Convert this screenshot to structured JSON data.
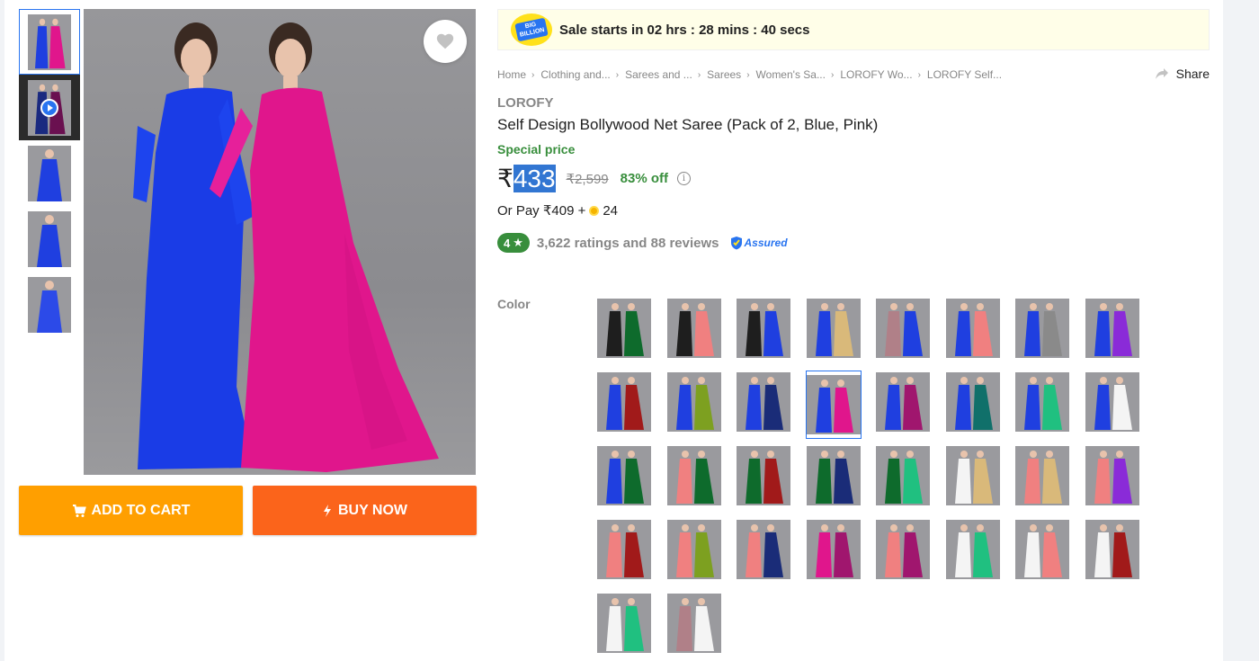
{
  "sale_banner": {
    "badge": "THE BIG BILLION DAYS",
    "text": "Sale starts in 02 hrs : 28 mins : 40 secs"
  },
  "breadcrumb": [
    "Home",
    "Clothing and...",
    "Sarees and ...",
    "Sarees",
    "Women's Sa...",
    "LOROFY Wo...",
    "LOROFY Self..."
  ],
  "share_label": "Share",
  "product": {
    "brand": "LOROFY",
    "title": "Self Design Bollywood Net Saree  (Pack of 2, Blue, Pink)",
    "special_label": "Special price",
    "currency": "₹",
    "price": "433",
    "mrp": "₹2,599",
    "discount": "83% off",
    "or_pay_prefix": "Or Pay ₹409 +",
    "or_pay_coins": "24",
    "rating": "4",
    "ratings_text": "3,622 ratings and 88 reviews",
    "assured_label": "Assured"
  },
  "buttons": {
    "add_to_cart": "ADD TO CART",
    "buy_now": "BUY NOW"
  },
  "color_label": "Color",
  "colors": {
    "accent": "#2874f0",
    "cart": "#ff9f00",
    "buy": "#fb641b",
    "green": "#388e3c"
  },
  "thumbnails": [
    {
      "left": "#1f3fe0",
      "right": "#e0168c",
      "active": true
    },
    {
      "video": true
    },
    {
      "left": "#1f3fe0"
    },
    {
      "left": "#1f3fe0"
    },
    {
      "left": "#2c4ae8"
    }
  ],
  "swatches": [
    [
      "#1e1e1e",
      "#0e6b2c"
    ],
    [
      "#1e1e1e",
      "#f08080"
    ],
    [
      "#1e1e1e",
      "#1f3fe0"
    ],
    [
      "#1f3fe0",
      "#d9b97a"
    ],
    [
      "#b08088",
      "#1f3fe0"
    ],
    [
      "#1f3fe0",
      "#f08080"
    ],
    [
      "#1f3fe0",
      "#8a8a8a"
    ],
    [
      "#1f3fe0",
      "#8a2bd8"
    ],
    [
      "#1f3fe0",
      "#a11a1a"
    ],
    [
      "#1f3fe0",
      "#7da020"
    ],
    [
      "#1f3fe0",
      "#1a2c78"
    ],
    [
      "#1f3fe0",
      "#e0168c"
    ],
    [
      "#1f3fe0",
      "#a0166e"
    ],
    [
      "#1f3fe0",
      "#10706a"
    ],
    [
      "#1f3fe0",
      "#20c080"
    ],
    [
      "#1f3fe0",
      "#f4f4f4"
    ],
    [
      "#1f3fe0",
      "#0e6b2c"
    ],
    [
      "#f08080",
      "#0e6b2c"
    ],
    [
      "#0e6b2c",
      "#a11a1a"
    ],
    [
      "#0e6b2c",
      "#1a2c78"
    ],
    [
      "#0e6b2c",
      "#20c080"
    ],
    [
      "#f4f4f4",
      "#d9b97a"
    ],
    [
      "#f08080",
      "#d9b97a"
    ],
    [
      "#f08080",
      "#8a2bd8"
    ],
    [
      "#f08080",
      "#a11a1a"
    ],
    [
      "#f08080",
      "#7da020"
    ],
    [
      "#f08080",
      "#1a2c78"
    ],
    [
      "#e0168c",
      "#a0166e"
    ],
    [
      "#f08080",
      "#a0166e"
    ],
    [
      "#f4f4f4",
      "#20c080"
    ],
    [
      "#f4f4f4",
      "#f08080"
    ],
    [
      "#f4f4f4",
      "#a11a1a"
    ],
    [
      "#f4f4f4",
      "#20c080"
    ],
    [
      "#b08088",
      "#f4f4f4"
    ]
  ],
  "selected_swatch_index": 11
}
